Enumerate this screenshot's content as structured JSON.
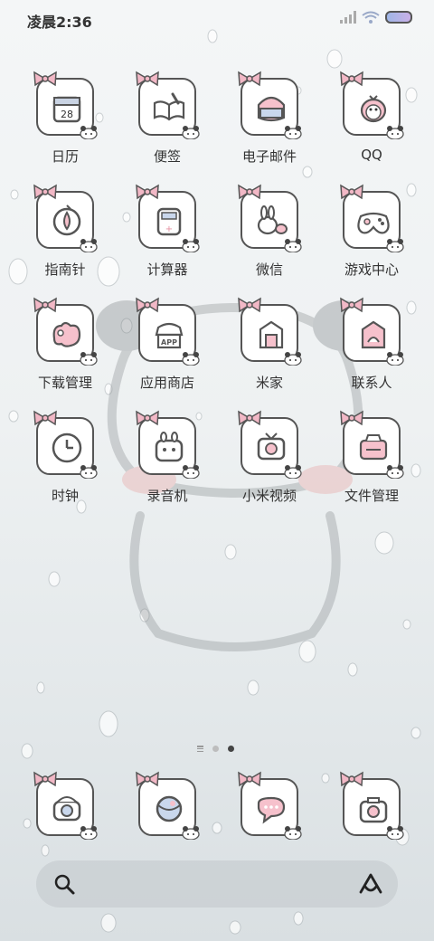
{
  "status_bar": {
    "time": "凌晨2:36"
  },
  "apps": [
    {
      "label": "日历",
      "icon": "calendar-icon",
      "date_text": "28"
    },
    {
      "label": "便签",
      "icon": "notebook-icon"
    },
    {
      "label": "电子邮件",
      "icon": "mail-icon"
    },
    {
      "label": "QQ",
      "icon": "penguin-icon"
    },
    {
      "label": "指南针",
      "icon": "compass-icon"
    },
    {
      "label": "计算器",
      "icon": "calculator-icon"
    },
    {
      "label": "微信",
      "icon": "wechat-bunny-icon"
    },
    {
      "label": "游戏中心",
      "icon": "gamepad-icon"
    },
    {
      "label": "下载管理",
      "icon": "download-icon"
    },
    {
      "label": "应用商店",
      "icon": "app-store-icon",
      "badge_text": "APP"
    },
    {
      "label": "米家",
      "icon": "home-icon"
    },
    {
      "label": "联系人",
      "icon": "contacts-icon"
    },
    {
      "label": "时钟",
      "icon": "clock-icon"
    },
    {
      "label": "录音机",
      "icon": "recorder-icon"
    },
    {
      "label": "小米视频",
      "icon": "tv-icon"
    },
    {
      "label": "文件管理",
      "icon": "files-icon"
    }
  ],
  "page_indicator": {
    "pages": 3,
    "active": 3
  },
  "dock": [
    {
      "icon": "camera-icon"
    },
    {
      "icon": "browser-globe-icon"
    },
    {
      "icon": "messages-icon"
    },
    {
      "icon": "photo-camera-icon"
    }
  ],
  "search_bar": {
    "left_icon": "search-icon",
    "right_icon": "assistant-icon"
  },
  "colors": {
    "bow": "#f2b8c6",
    "tile_border": "#555555",
    "accent_pink": "#f6c1cc"
  }
}
